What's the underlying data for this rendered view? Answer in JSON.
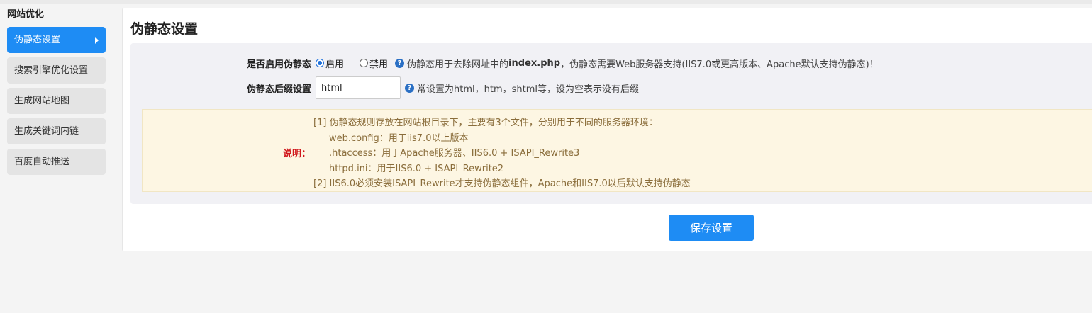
{
  "sidebar": {
    "title": "网站优化",
    "items": [
      {
        "label": "伪静态设置",
        "active": true
      },
      {
        "label": "搜索引擎优化设置",
        "active": false
      },
      {
        "label": "生成网站地图",
        "active": false
      },
      {
        "label": "生成关键词内链",
        "active": false
      },
      {
        "label": "百度自动推送",
        "active": false
      }
    ]
  },
  "main": {
    "title": "伪静态设置",
    "rewrite": {
      "label": "是否启用伪静态",
      "option_on": "启用",
      "option_off": "禁用",
      "selected": "启用",
      "hint_prefix": "伪静态用于去除网址中的",
      "hint_bold": "index.php",
      "hint_suffix": "，伪静态需要Web服务器支持(IIS7.0或更高版本、Apache默认支持伪静态)！"
    },
    "suffix": {
      "label": "伪静态后缀设置",
      "value": "html",
      "hint": "常设置为html，htm，shtml等，设为空表示没有后缀"
    },
    "note": {
      "label": "说明：",
      "lines": [
        "[1] 伪静态规则存放在网站根目录下，主要有3个文件，分别用于不同的服务器环境：",
        "web.config：用于iis7.0以上版本",
        ".htaccess：用于Apache服务器、IIS6.0 + ISAPI_Rewrite3",
        "httpd.ini：用于IIS6.0 + ISAPI_Rewrite2",
        "[2] IIS6.0必须安装ISAPI_Rewrite才支持伪静态组件，Apache和IIS7.0以后默认支持伪静态"
      ]
    },
    "save_label": "保存设置"
  },
  "colors": {
    "accent": "#1e8cf4",
    "note_bg": "#fdf6e3",
    "note_text": "#8a6d3b",
    "note_label": "#d0161b"
  }
}
